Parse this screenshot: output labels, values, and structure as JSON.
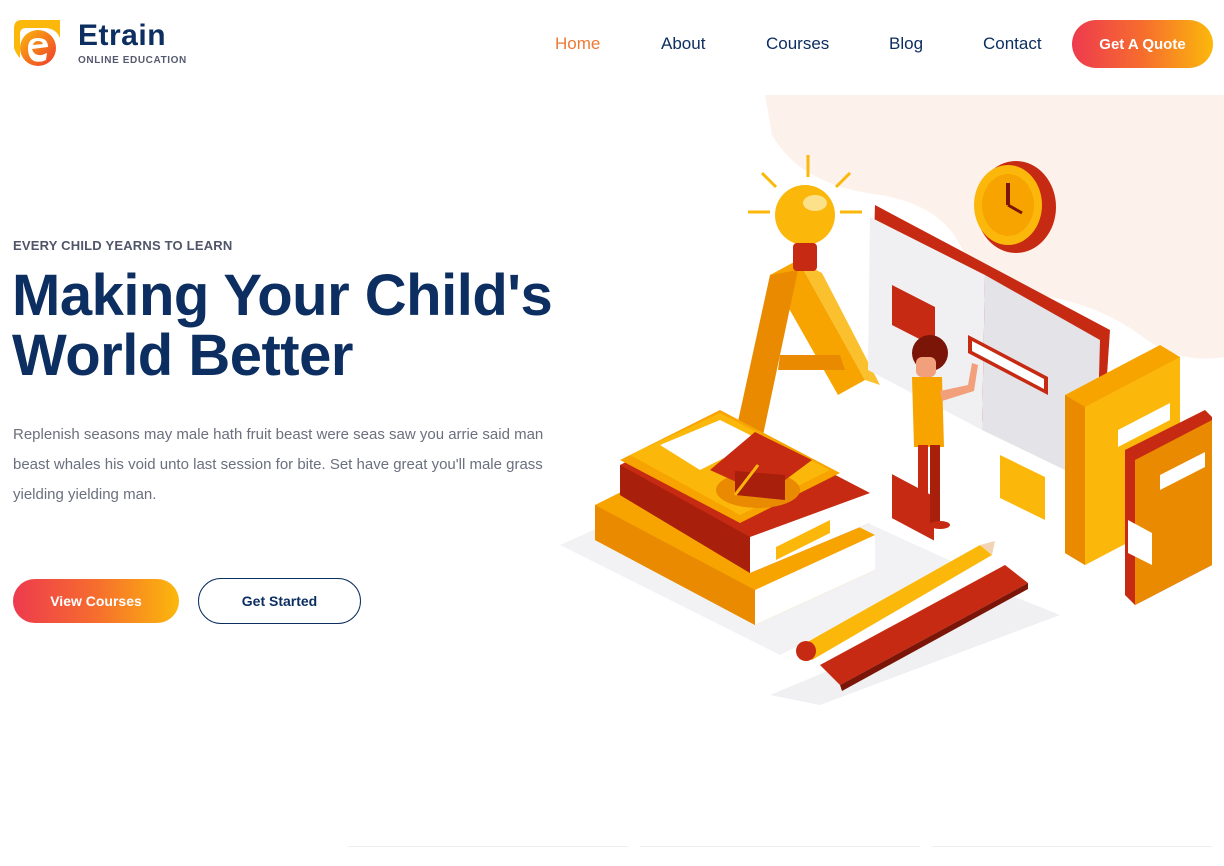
{
  "header": {
    "brand": "Etrain",
    "tagline": "ONLINE EDUCATION",
    "logo_icon": "etrain-e-logo",
    "nav": [
      {
        "label": "Home",
        "active": true
      },
      {
        "label": "About",
        "active": false
      },
      {
        "label": "Courses",
        "active": false
      },
      {
        "label": "Blog",
        "active": false
      },
      {
        "label": "Contact",
        "active": false
      }
    ],
    "quote_label": "Get A Quote"
  },
  "hero": {
    "eyebrow": "EVERY CHILD YEARNS TO LEARN",
    "title_line1": "Making Your Child's",
    "title_line2": "World Better",
    "description": "Replenish seasons may male hath fruit beast were seas saw you arrie said man beast whales his void unto last session for bite. Set have great you'll male grass yielding yielding man.",
    "primary_cta": "View Courses",
    "secondary_cta": "Get Started"
  },
  "colors": {
    "navy": "#0c2e60",
    "accent_orange": "#ee7a35",
    "gradient_start": "#ee3a4e",
    "gradient_end": "#fbb80b",
    "body_text": "#6b6f7e"
  }
}
